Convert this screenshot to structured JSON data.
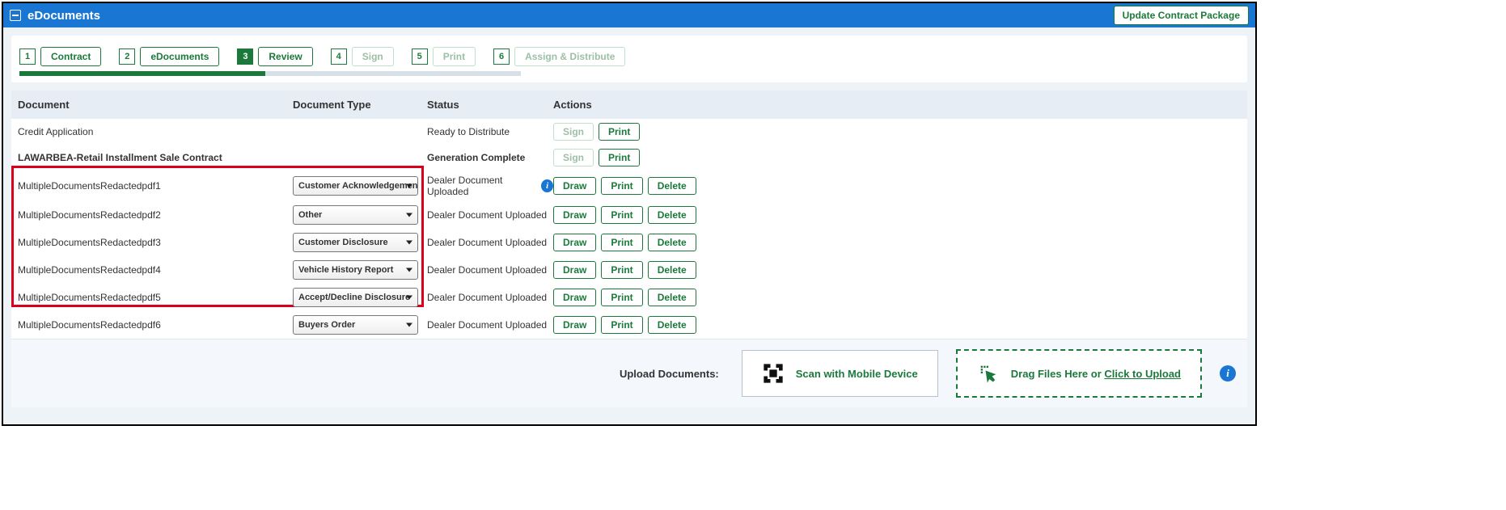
{
  "header": {
    "title": "eDocuments",
    "update_btn": "Update Contract Package"
  },
  "steps": [
    {
      "num": "1",
      "label": "Contract",
      "active": false,
      "disabled": false
    },
    {
      "num": "2",
      "label": "eDocuments",
      "active": false,
      "disabled": false
    },
    {
      "num": "3",
      "label": "Review",
      "active": true,
      "disabled": false
    },
    {
      "num": "4",
      "label": "Sign",
      "active": false,
      "disabled": true
    },
    {
      "num": "5",
      "label": "Print",
      "active": false,
      "disabled": true
    },
    {
      "num": "6",
      "label": "Assign & Distribute",
      "active": false,
      "disabled": true
    }
  ],
  "columns": {
    "doc": "Document",
    "type": "Document Type",
    "status": "Status",
    "actions": "Actions"
  },
  "rows": [
    {
      "name": "Credit Application",
      "bold": false,
      "type": "",
      "status": "Ready to Distribute",
      "info": false,
      "actions": [
        {
          "label": "Sign",
          "disabled": true
        },
        {
          "label": "Print",
          "disabled": false
        }
      ]
    },
    {
      "name": "LAWARBEA-Retail Installment Sale Contract",
      "bold": true,
      "type": "",
      "status": "Generation Complete",
      "info": false,
      "actions": [
        {
          "label": "Sign",
          "disabled": true
        },
        {
          "label": "Print",
          "disabled": false
        }
      ]
    },
    {
      "name": "MultipleDocumentsRedactedpdf1",
      "bold": false,
      "type": "Customer Acknowledgement",
      "status": "Dealer Document Uploaded",
      "info": true,
      "actions": [
        {
          "label": "Draw",
          "disabled": false
        },
        {
          "label": "Print",
          "disabled": false
        },
        {
          "label": "Delete",
          "disabled": false
        }
      ]
    },
    {
      "name": "MultipleDocumentsRedactedpdf2",
      "bold": false,
      "type": "Other",
      "status": "Dealer Document Uploaded",
      "info": false,
      "actions": [
        {
          "label": "Draw",
          "disabled": false
        },
        {
          "label": "Print",
          "disabled": false
        },
        {
          "label": "Delete",
          "disabled": false
        }
      ]
    },
    {
      "name": "MultipleDocumentsRedactedpdf3",
      "bold": false,
      "type": "Customer Disclosure",
      "status": "Dealer Document Uploaded",
      "info": false,
      "actions": [
        {
          "label": "Draw",
          "disabled": false
        },
        {
          "label": "Print",
          "disabled": false
        },
        {
          "label": "Delete",
          "disabled": false
        }
      ]
    },
    {
      "name": "MultipleDocumentsRedactedpdf4",
      "bold": false,
      "type": "Vehicle History Report",
      "status": "Dealer Document Uploaded",
      "info": false,
      "actions": [
        {
          "label": "Draw",
          "disabled": false
        },
        {
          "label": "Print",
          "disabled": false
        },
        {
          "label": "Delete",
          "disabled": false
        }
      ]
    },
    {
      "name": "MultipleDocumentsRedactedpdf5",
      "bold": false,
      "type": "Accept/Decline Disclosure",
      "status": "Dealer Document Uploaded",
      "info": false,
      "actions": [
        {
          "label": "Draw",
          "disabled": false
        },
        {
          "label": "Print",
          "disabled": false
        },
        {
          "label": "Delete",
          "disabled": false
        }
      ]
    },
    {
      "name": "MultipleDocumentsRedactedpdf6",
      "bold": false,
      "type": "Buyers Order",
      "status": "Dealer Document Uploaded",
      "info": false,
      "actions": [
        {
          "label": "Draw",
          "disabled": false
        },
        {
          "label": "Print",
          "disabled": false
        },
        {
          "label": "Delete",
          "disabled": false
        }
      ]
    }
  ],
  "upload": {
    "label": "Upload Documents:",
    "scan_label": "Scan with Mobile Device",
    "drop_prefix": "Drag Files Here or ",
    "drop_link": "Click to Upload"
  }
}
